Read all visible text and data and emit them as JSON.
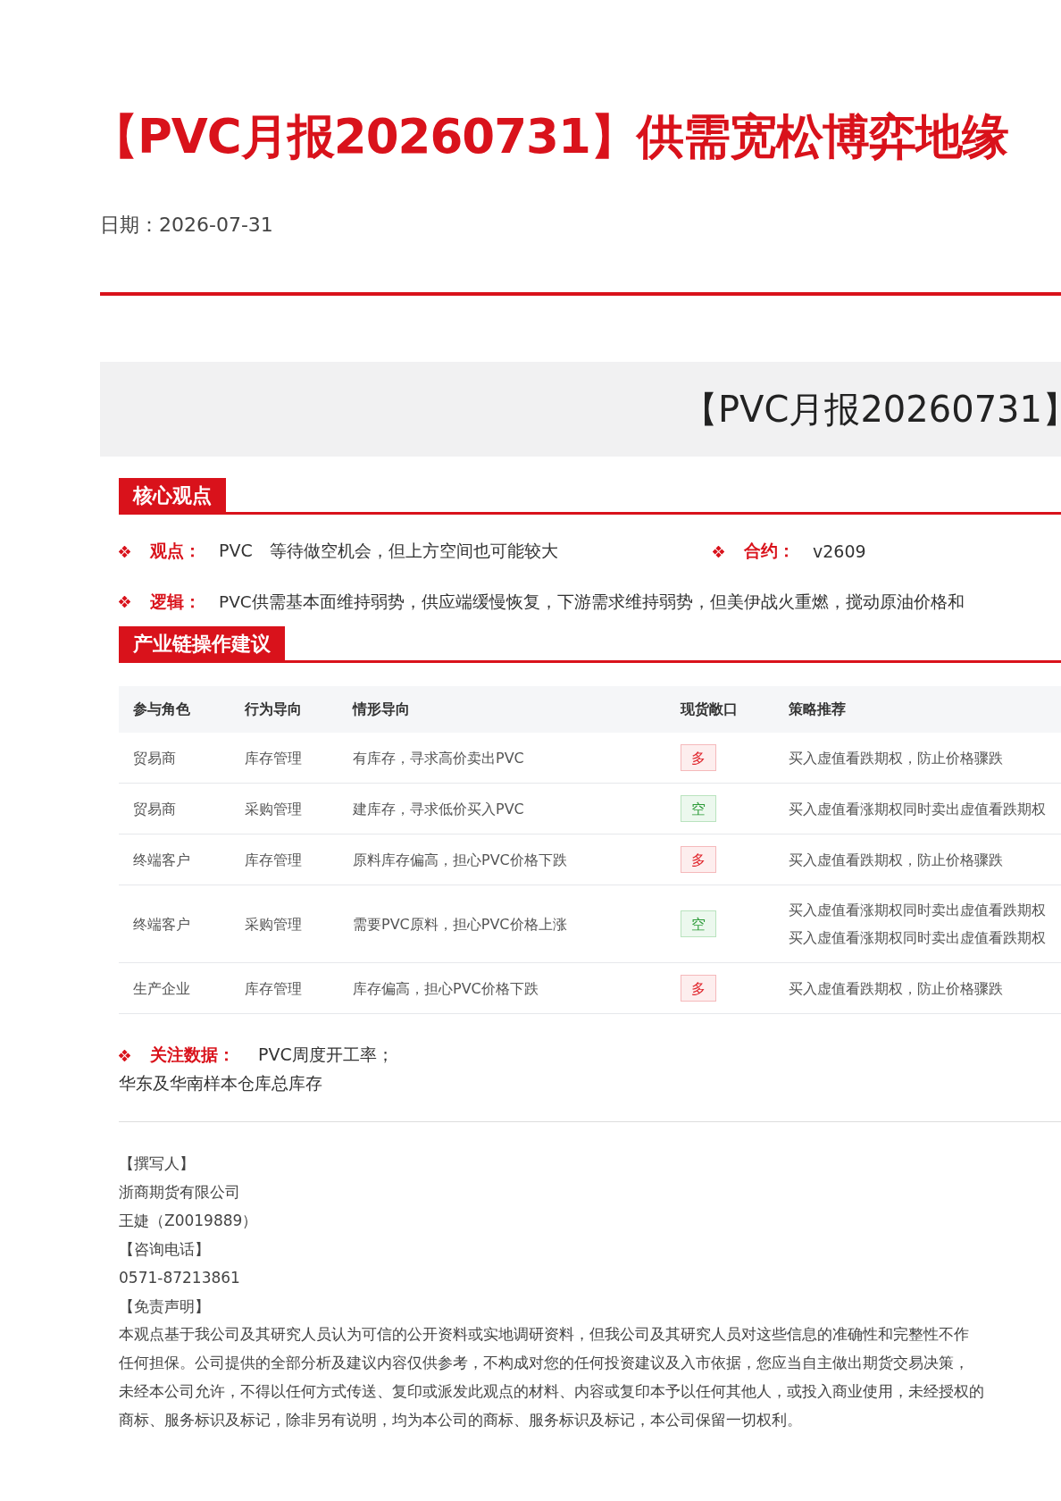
{
  "title": "【PVC月报20260731】供需宽松博弈地缘",
  "date": {
    "label": "日期：",
    "value": "2026-07-31"
  },
  "banner": "【PVC月报20260731】",
  "sections": [
    {
      "title": "核心观点"
    },
    {
      "title": "产业链操作建议"
    }
  ],
  "view": {
    "label": "观点：",
    "value": "PVC　等待做空机会，但上方空间也可能较大"
  },
  "contract": {
    "label": "合约：",
    "value": "v2609"
  },
  "logic": {
    "label": "逻辑：",
    "value": "PVC供需基本面维持弱势，供应端缓慢恢复，下游需求维持弱势，但美伊战火重燃，搅动原油价格和"
  },
  "table": {
    "columns": [
      "参与角色",
      "行为导向",
      "情形导向",
      "现货敞口",
      "策略推荐"
    ],
    "rows": [
      {
        "role": "贸易商",
        "behavior": "库存管理",
        "situation": "有库存，寻求高价卖出PVC",
        "exposure": {
          "text": "多",
          "kind": "long"
        },
        "strategy": "买入虚值看跌期权，防止价格骤跌"
      },
      {
        "role": "贸易商",
        "behavior": "采购管理",
        "situation": "建库存，寻求低价买入PVC",
        "exposure": {
          "text": "空",
          "kind": "short"
        },
        "strategy": "买入虚值看涨期权同时卖出虚值看跌期权"
      },
      {
        "role": "终端客户",
        "behavior": "库存管理",
        "situation": "原料库存偏高，担心PVC价格下跌",
        "exposure": {
          "text": "多",
          "kind": "long"
        },
        "strategy": "买入虚值看跌期权，防止价格骤跌"
      },
      {
        "role": "终端客户",
        "behavior": "采购管理",
        "situation": "需要PVC原料，担心PVC价格上涨",
        "exposure": {
          "text": "空",
          "kind": "short"
        },
        "strategy": "买入虚值看涨期权同时卖出虚值看跌期权买入虚值看涨期权同时卖出虚值看跌期权"
      },
      {
        "role": "生产企业",
        "behavior": "库存管理",
        "situation": "库存偏高，担心PVC价格下跌",
        "exposure": {
          "text": "多",
          "kind": "long"
        },
        "strategy": "买入虚值看跌期权，防止价格骤跌"
      }
    ]
  },
  "focus": {
    "label": "关注数据：",
    "items": [
      "PVC周度开工率；",
      "华东及华南样本仓库总库存"
    ]
  },
  "contact": [
    "【撰写人】",
    "浙商期货有限公司",
    "王婕（Z0019889）",
    "【咨询电话】",
    "0571-87213861",
    "【免责声明】"
  ],
  "disclaimer_lines": [
    "本观点基于我公司及其研究人员认为可信的公开资料或实地调研资料，但我公司及其研究人员对这些信息的准确性和完整性不作",
    "任何担保。公司提供的全部分析及建议内容仅供参考，不构成对您的任何投资建议及入市依据，您应当自主做出期货交易决策，",
    "未经本公司允许，不得以任何方式传送、复印或派发此观点的材料、内容或复印本予以任何其他人，或投入商业使用，未经授权的",
    "商标、服务标识及标记，除非另有说明，均为本公司的商标、服务标识及标记，本公司保留一切权利。"
  ]
}
